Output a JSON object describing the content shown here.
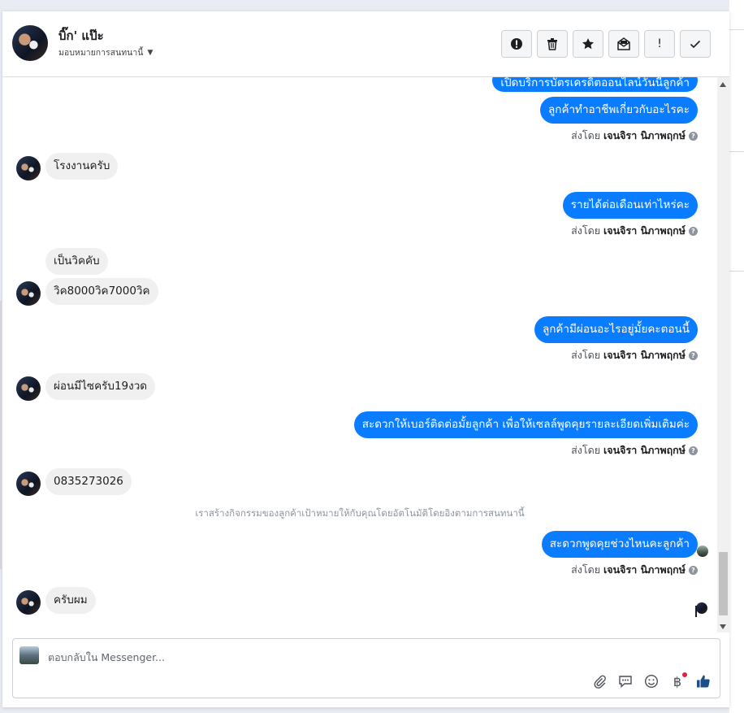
{
  "contact": {
    "name": "บิ๊ก' แป๊ะ",
    "assign_label": "มอบหมายการสนทนานี้"
  },
  "toolbar": {
    "buttons": [
      {
        "name": "spam-button",
        "icon": "exclamation-circle-icon"
      },
      {
        "name": "delete-button",
        "icon": "trash-icon"
      },
      {
        "name": "star-button",
        "icon": "star-icon"
      },
      {
        "name": "mark-unread-button",
        "icon": "envelope-open-icon"
      },
      {
        "name": "follow-up-button",
        "icon": "exclamation-icon",
        "label": "!"
      },
      {
        "name": "done-button",
        "icon": "check-icon"
      }
    ]
  },
  "messages": {
    "partial_top": "เปิดบริการบัตรเครดิตออนไลน์วันนี้ลูกค้า",
    "m1": "ลูกค้าทำอาชีพเกี่ยวกับอะไรคะ",
    "m2": "โรงงานครับ",
    "m3": "รายได้ต่อเดือนเท่าไหร่คะ",
    "m4a": "เป็นวิคคับ",
    "m4b": "วิค8000วิค7000วิค",
    "m5": "ลูกค้ามีผ่อนอะไรอยู่มั้ยคะตอนนี้",
    "m6": "ผ่อนมีไซครับ19งวด",
    "m7": "สะดวกให้เบอร์ติดต่อมั้ยลูกค้า เพื่อให้เซลล์พูดคุยรายละเอียดเพิ่มเติมค่ะ",
    "m8": "0835273026",
    "system_note": "เราสร้างกิจกรรมของลูกค้าเป้าหมายให้กับคุณโดยอัตโนมัติโดยอิงตามการสนทนานี้",
    "m9": "สะดวกพูดคุยช่วงไหนคะลูกค้า",
    "m10": "ครับผม"
  },
  "sent_by": {
    "prefix": "ส่งโดย",
    "agent": "เจนจิรา นิภาพฤกษ์"
  },
  "composer": {
    "placeholder": "ตอบกลับใน Messenger...",
    "currency_symbol": "฿",
    "tools": [
      "paperclip-icon",
      "chat-bubble-icon",
      "smiley-icon",
      "baht-icon",
      "thumbs-up-icon"
    ]
  },
  "colors": {
    "outgoing_bubble": "#0a7cff",
    "incoming_bubble": "#f0f0f0",
    "like_button": "#0a7cff",
    "notification_dot": "#e41e3f"
  }
}
